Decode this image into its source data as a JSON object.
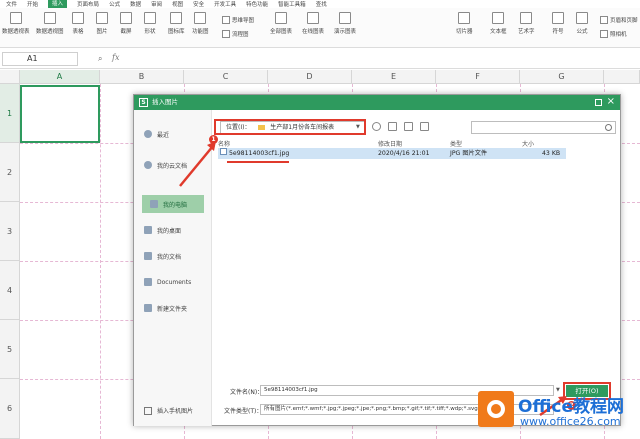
{
  "menubar": {
    "tabs": [
      "文件",
      "开始",
      "插入",
      "页面布局",
      "公式",
      "数据",
      "审阅",
      "视图",
      "安全",
      "开发工具",
      "特色功能",
      "智能工具箱",
      "查找"
    ],
    "active_tab": "插入"
  },
  "toolbar": {
    "pivot_table": "数据透视表",
    "pivot_chart": "数据透视图",
    "table": "表格",
    "picture": "图片",
    "screenshot": "截屏",
    "shapes": "形状",
    "icon_library": "图标库",
    "function_chart": "功能图",
    "mindmap": "思维导图",
    "flowchart": "流程图",
    "all_charts": "全部图表",
    "online_charts": "在线图表",
    "slide_charts": "演示图表",
    "slicer": "切片器",
    "textbox": "文本框",
    "wordart": "艺术字",
    "symbol": "符号",
    "formula": "公式",
    "header_footer": "页眉和页脚",
    "camera": "照相机"
  },
  "formula_bar": {
    "cell_ref": "A1",
    "fx": "fx"
  },
  "grid": {
    "columns": [
      "A",
      "B",
      "C",
      "D",
      "E",
      "F",
      "G"
    ],
    "rows": [
      "1",
      "2",
      "3",
      "4",
      "5",
      "6"
    ]
  },
  "dialog": {
    "title": "插入图片",
    "logo": "S",
    "sidebar": {
      "items": [
        "最近",
        "我的云文档",
        "我的电脑",
        "我的桌面",
        "我的文档",
        "Documents",
        "新建文件夹"
      ],
      "selected": "我的电脑",
      "bottom": "插入手机图片"
    },
    "location_label": "位置(I)：",
    "location_value": "生产部1月份各车间报表",
    "columns": [
      "名称",
      "修改日期",
      "类型",
      "大小"
    ],
    "files": [
      {
        "name": "5e98114003cf1.jpg",
        "date": "2020/4/16 21:01",
        "type": "JPG 图片文件",
        "size": "43 KB"
      }
    ],
    "filename_label": "文件名(N)：",
    "filename_value": "5e98114003cf1.jpg",
    "filetype_label": "文件类型(T)：",
    "filetype_value": "所有图片(*.emf;*.wmf;*.jpg;*.jpeg;*.jpe;*.png;*.bmp;*.gif;*.tif;*.tiff;*.wdp;*.svg",
    "open_button": "打开(O)"
  },
  "annotations": {
    "badge_1": "1",
    "badge_2": "2"
  },
  "watermark": {
    "title": "Office教程网",
    "url": "www.office26.com"
  },
  "colors": {
    "accent": "#2e9a5e",
    "annotation": "#e03a2c",
    "selection": "#cfe3f5"
  }
}
